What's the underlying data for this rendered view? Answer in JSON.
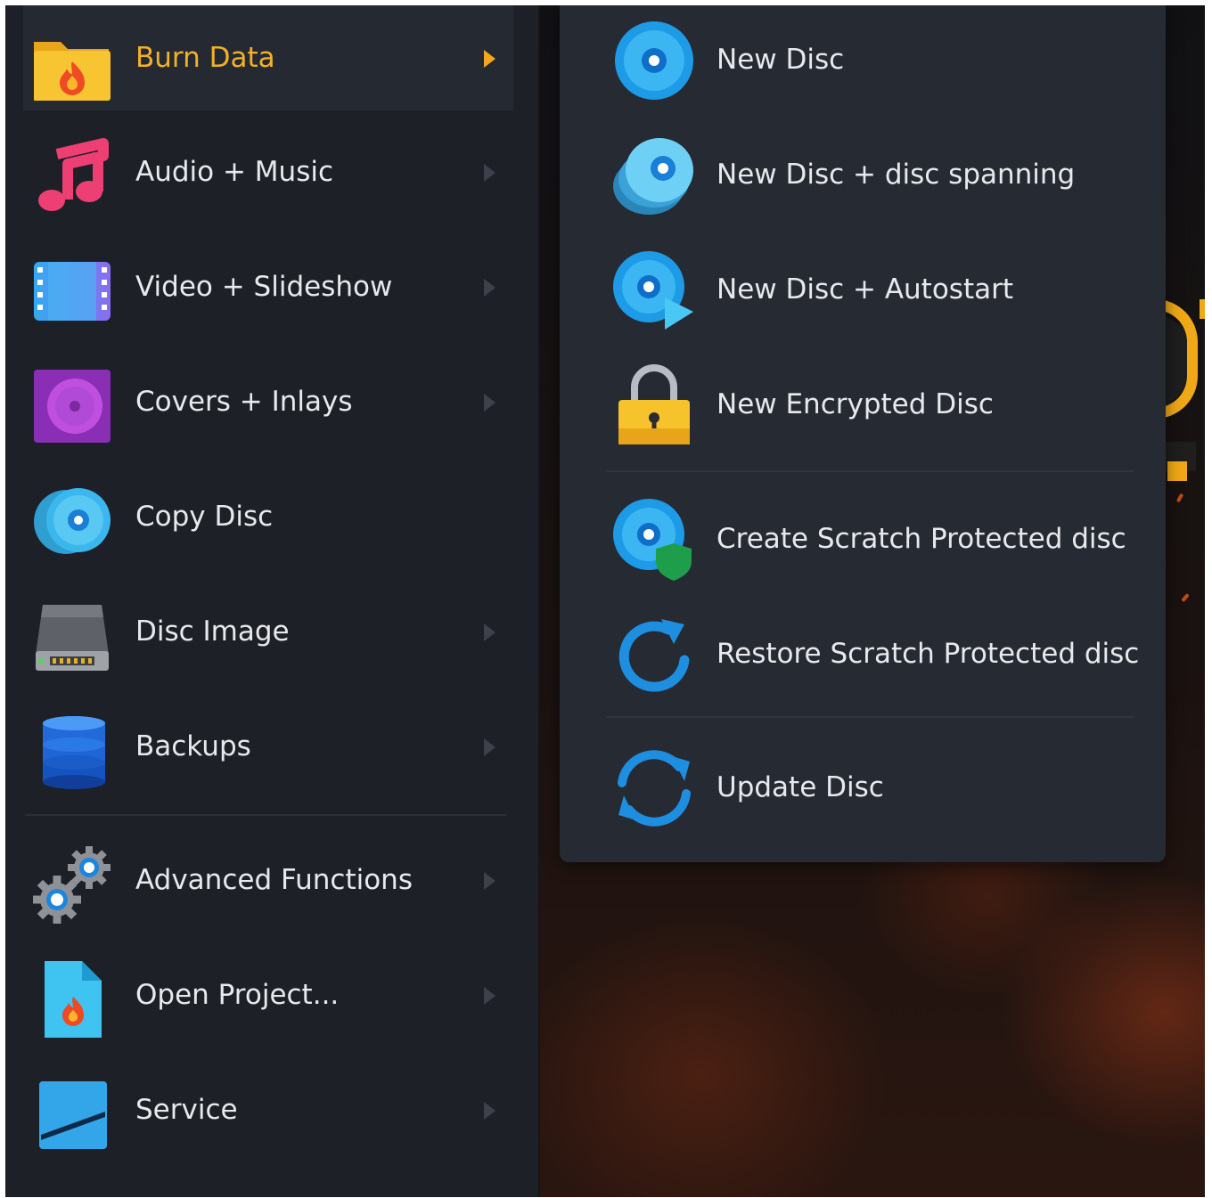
{
  "main_menu": {
    "items": [
      {
        "label": "Burn Data",
        "icon": "folder-flame-icon",
        "active": true
      },
      {
        "label": "Audio + Music",
        "icon": "music-note-icon"
      },
      {
        "label": "Video + Slideshow",
        "icon": "film-strip-icon"
      },
      {
        "label": "Covers + Inlays",
        "icon": "disc-cover-icon"
      },
      {
        "label": "Copy Disc",
        "icon": "copy-disc-icon"
      },
      {
        "label": "Disc Image",
        "icon": "hard-drive-icon"
      },
      {
        "label": "Backups",
        "icon": "database-icon"
      },
      {
        "label": "Advanced Functions",
        "icon": "gears-icon"
      },
      {
        "label": "Open Project...",
        "icon": "project-file-icon"
      },
      {
        "label": "Service",
        "icon": "service-icon"
      }
    ]
  },
  "submenu": {
    "items": [
      {
        "label": "New Disc",
        "icon": "disc-icon"
      },
      {
        "label": "New Disc + disc spanning",
        "icon": "disc-stack-icon"
      },
      {
        "label": "New Disc + Autostart",
        "icon": "disc-play-icon"
      },
      {
        "label": "New Encrypted Disc",
        "icon": "padlock-icon"
      },
      {
        "label": "Create Scratch Protected disc",
        "icon": "disc-shield-icon"
      },
      {
        "label": "Restore Scratch Protected disc",
        "icon": "restore-icon"
      },
      {
        "label": "Update Disc",
        "icon": "refresh-icon"
      }
    ]
  },
  "colors": {
    "accent": "#f2b12a",
    "menu_bg": "#1d2027",
    "submenu_bg": "#262a32",
    "disc_blue": "#1e9be6"
  }
}
